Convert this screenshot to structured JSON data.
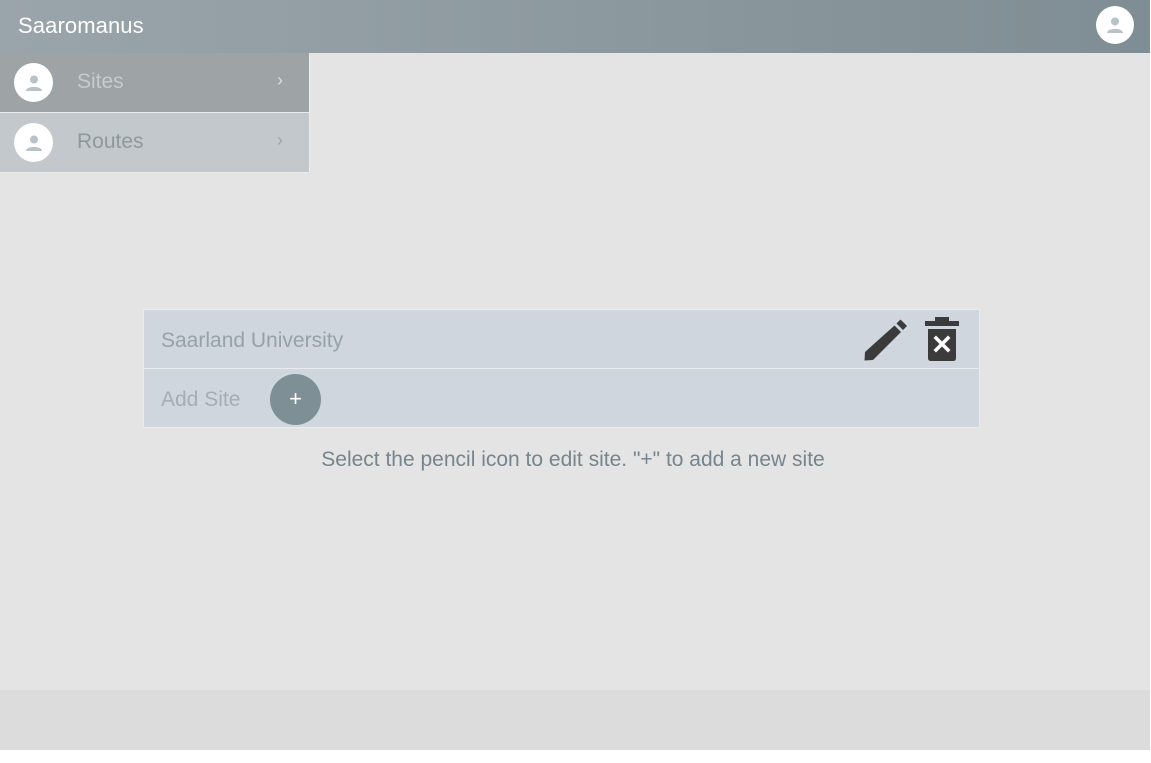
{
  "header": {
    "title": "Saaromanus",
    "avatar_icon": "person-icon"
  },
  "sidebar": {
    "items": [
      {
        "label": "Sites",
        "icon": "person-icon",
        "chevron": "›",
        "active": true
      },
      {
        "label": "Routes",
        "icon": "person-icon",
        "chevron": "›",
        "active": false
      }
    ]
  },
  "sites": {
    "rows": [
      {
        "name": "Saarland University",
        "edit_icon": "pencil-icon",
        "delete_icon": "trash-x-icon"
      }
    ],
    "add_label": "Add Site",
    "add_symbol": "+"
  },
  "hint": {
    "text": "Select the pencil icon to edit site. \"+\" to add a new site"
  },
  "colors": {
    "header_start": "#9aa5ab",
    "header_end": "#7f8e94",
    "row_background": "#cfd6dd",
    "add_button": "#7e8f95",
    "icon_dark": "#3b3b3b",
    "page_background": "#e4e4e4"
  }
}
